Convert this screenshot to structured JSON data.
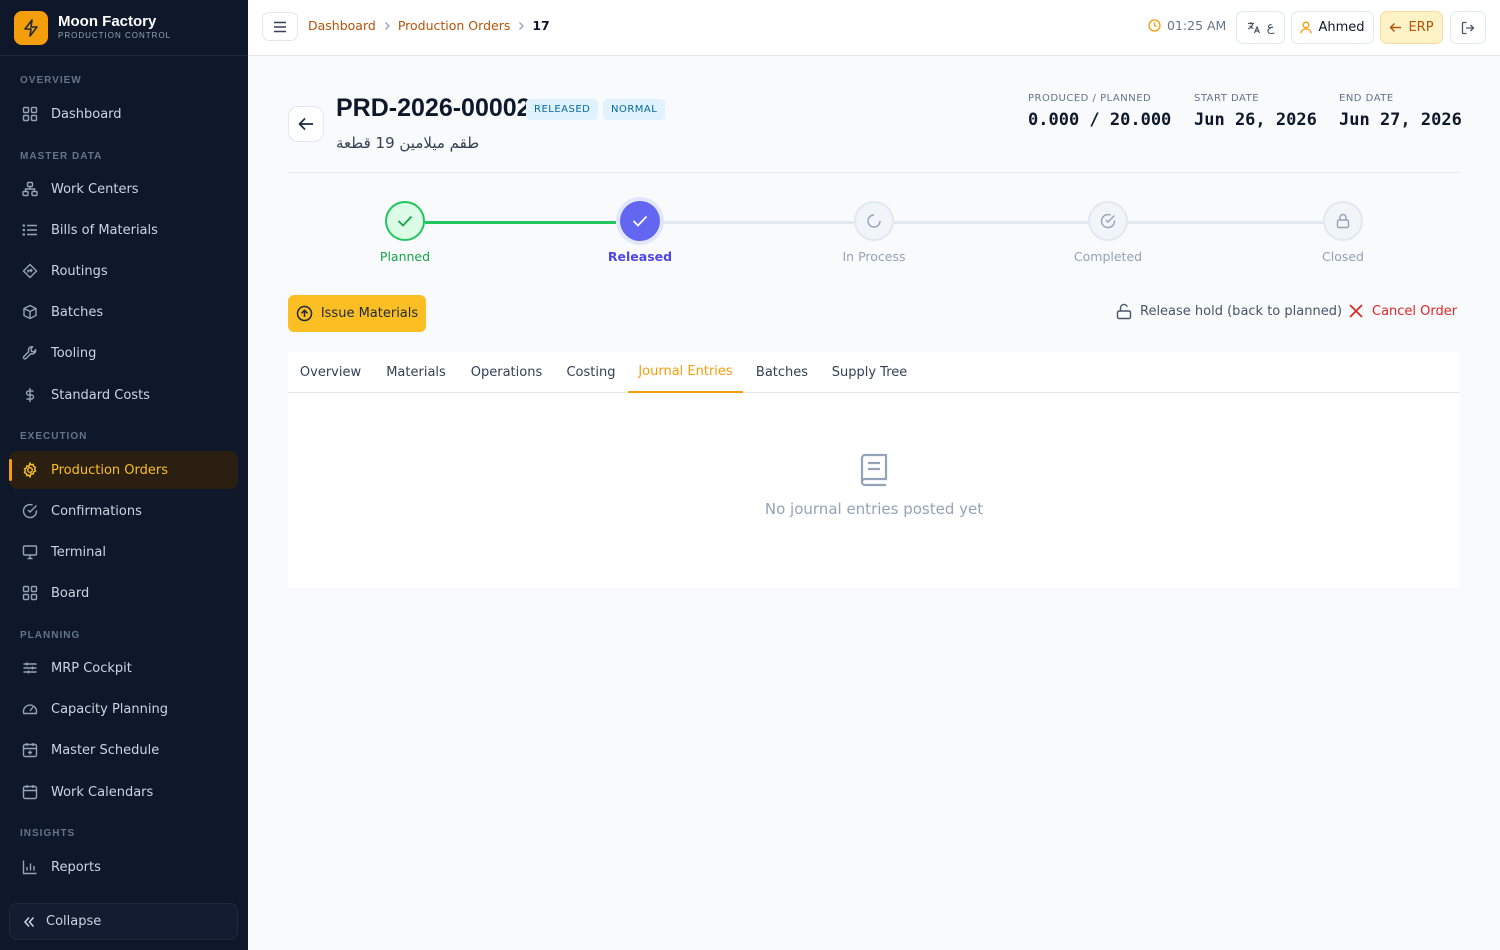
{
  "brand": {
    "name": "Moon Factory",
    "subtitle": "PRODUCTION CONTROL"
  },
  "sidebar": {
    "sections": [
      "OVERVIEW",
      "MASTER DATA",
      "EXECUTION",
      "PLANNING",
      "INSIGHTS"
    ],
    "items": [
      {
        "label": "Dashboard",
        "icon": "grid-icon"
      },
      {
        "label": "Work Centers",
        "icon": "network-icon"
      },
      {
        "label": "Bills of Materials",
        "icon": "list-icon"
      },
      {
        "label": "Routings",
        "icon": "route-icon"
      },
      {
        "label": "Batches",
        "icon": "package-icon"
      },
      {
        "label": "Tooling",
        "icon": "wrench-icon"
      },
      {
        "label": "Standard Costs",
        "icon": "dollar-icon"
      },
      {
        "label": "Production Orders",
        "icon": "gear-icon",
        "active": true
      },
      {
        "label": "Confirmations",
        "icon": "check-circle-icon"
      },
      {
        "label": "Terminal",
        "icon": "monitor-icon"
      },
      {
        "label": "Board",
        "icon": "grid-icon"
      },
      {
        "label": "MRP Cockpit",
        "icon": "sliders-icon"
      },
      {
        "label": "Capacity Planning",
        "icon": "gauge-icon"
      },
      {
        "label": "Master Schedule",
        "icon": "calendar-icon"
      },
      {
        "label": "Work Calendars",
        "icon": "calendar-icon"
      },
      {
        "label": "Reports",
        "icon": "bar-chart-icon"
      }
    ],
    "collapse_label": "Collapse"
  },
  "topbar": {
    "breadcrumb": [
      "Dashboard",
      "Production Orders",
      "17"
    ],
    "time": "01:25 AM",
    "lang_label": "ع",
    "user_name": "Ahmed",
    "erp_label": "ERP"
  },
  "order": {
    "number": "PRD-2026-00002",
    "status_badge": "RELEASED",
    "priority_badge": "NORMAL",
    "product": "طقم ميلامين 19 قطعة",
    "produced_label": "PRODUCED / PLANNED",
    "produced_value": "0.000 / 20.000",
    "start_label": "START DATE",
    "start_value": "Jun 26, 2026",
    "end_label": "END DATE",
    "end_value": "Jun 27, 2026"
  },
  "stepper": {
    "steps": [
      "Planned",
      "Released",
      "In Process",
      "Completed",
      "Closed"
    ],
    "current_index": 1
  },
  "actions": {
    "issue_label": "Issue Materials",
    "hold_label": "Release hold (back to planned)",
    "cancel_label": "Cancel Order"
  },
  "tabs": [
    "Overview",
    "Materials",
    "Operations",
    "Costing",
    "Journal Entries",
    "Batches",
    "Supply Tree"
  ],
  "active_tab": "Journal Entries",
  "empty_state": "No journal entries posted yet",
  "colors": {
    "accent": "#f59e0b",
    "done": "#22c55e",
    "current": "#6366f1",
    "danger": "#dc2626",
    "sidebar_bg": "#0f172a"
  }
}
